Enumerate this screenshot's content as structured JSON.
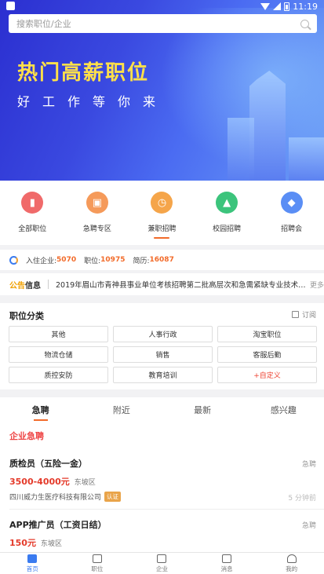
{
  "statusbar": {
    "time": "11:19"
  },
  "search": {
    "placeholder": "搜索职位/企业"
  },
  "banner": {
    "title": "热门高薪职位",
    "subtitle": "好工作等你来"
  },
  "categories": [
    {
      "label": "全部职位",
      "color": "#f06a6a",
      "icon": "document-icon"
    },
    {
      "label": "急聘专区",
      "color": "#f59a5a",
      "icon": "bag-icon"
    },
    {
      "label": "兼职招聘",
      "color": "#f5a54a",
      "icon": "clock-icon"
    },
    {
      "label": "校园招聘",
      "color": "#3cc47c",
      "icon": "graduation-icon"
    },
    {
      "label": "招聘会",
      "color": "#5a8ef5",
      "icon": "handshake-icon"
    }
  ],
  "stats": {
    "companies_label": "入住企业:",
    "companies": "5070",
    "jobs_label": "职位:",
    "jobs": "10975",
    "resumes_label": "简历:",
    "resumes": "16087"
  },
  "notice": {
    "label_a": "公告",
    "label_b": "信息",
    "text": "2019年眉山市青神县事业单位考核招聘第二批高层次和急需紧缺专业技术…",
    "more": "更多"
  },
  "job_categories": {
    "title": "职位分类",
    "subscribe": "订阅",
    "items": [
      "其他",
      "人事行政",
      "淘宝职位",
      "物流仓储",
      "销售",
      "客服后勤",
      "质控安防",
      "教育培训",
      "+自定义"
    ]
  },
  "tabs": [
    "急聘",
    "附近",
    "最新",
    "感兴趣"
  ],
  "list": {
    "section_title": "企业急聘",
    "jobs": [
      {
        "title": "质检员（五险一金）",
        "tag": "急聘",
        "salary": "3500-4000元",
        "area": "东坡区",
        "company": "四川威力生医疗科技有限公司",
        "badge": "认证",
        "time": "5 分钟前"
      },
      {
        "title": "APP推广员（工资日结）",
        "tag": "急聘",
        "salary": "150元",
        "area": "东坡区"
      }
    ]
  },
  "nav": [
    "首页",
    "职位",
    "企业",
    "消息",
    "我的"
  ]
}
